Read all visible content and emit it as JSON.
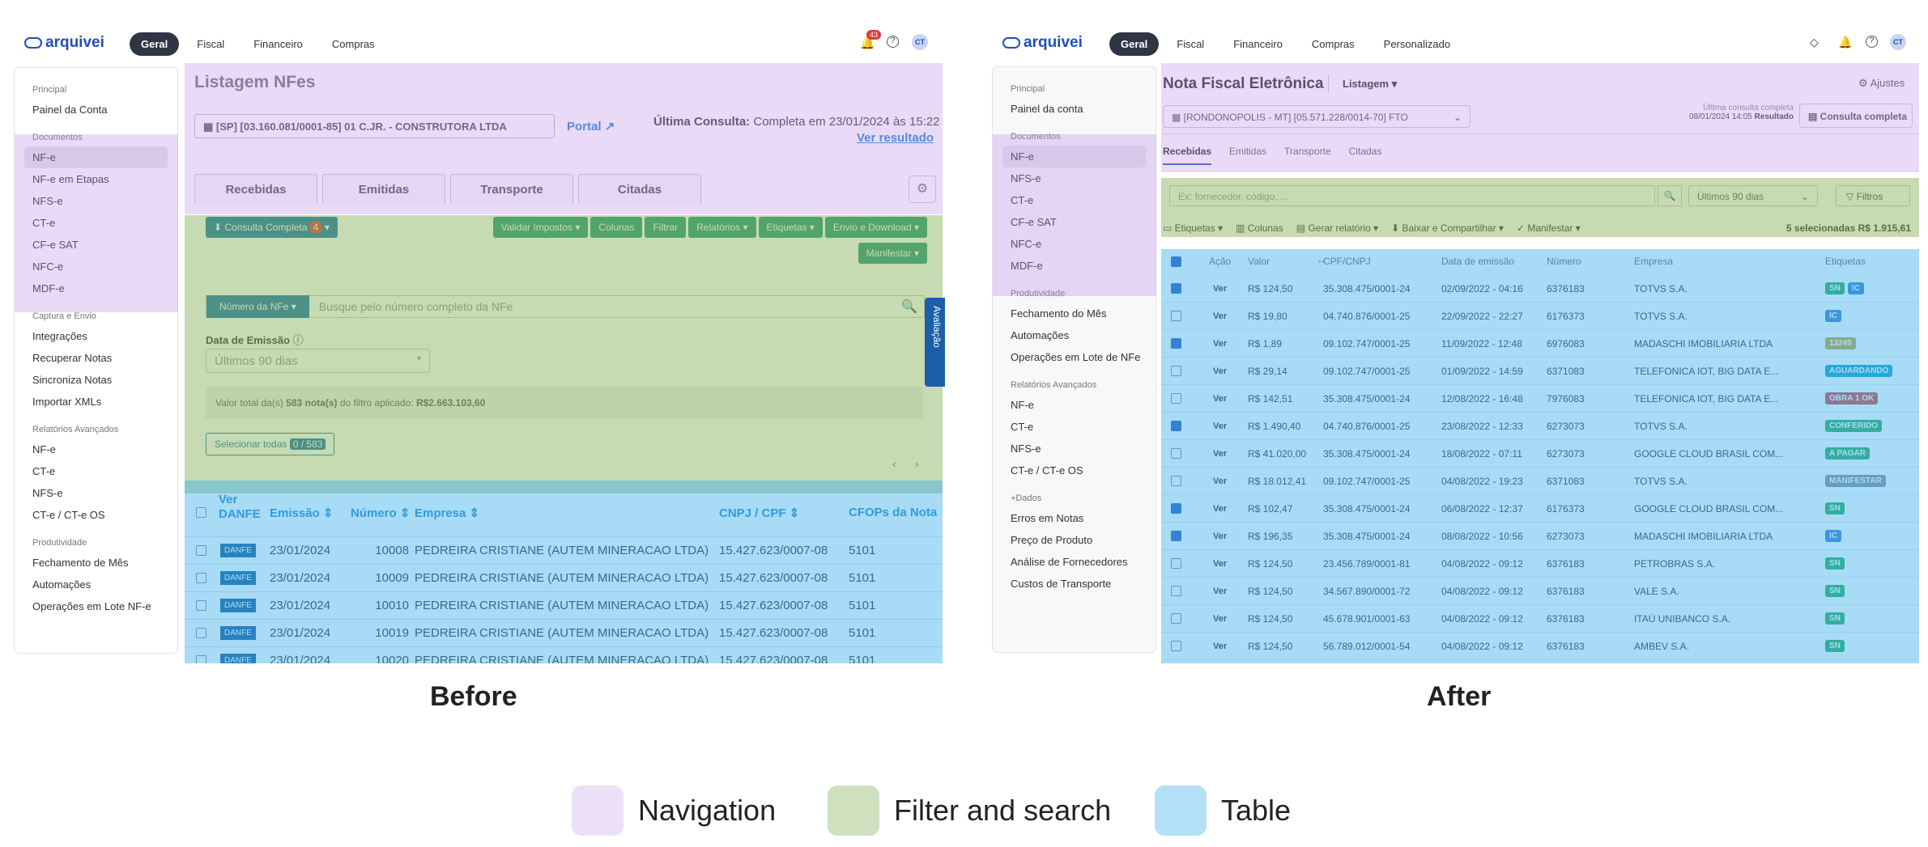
{
  "before": {
    "nav": {
      "brand": "arquivei",
      "tabs": [
        "Geral",
        "Fiscal",
        "Financeiro",
        "Compras"
      ],
      "notif_count": "43",
      "avatar": "CT"
    },
    "sidebar": [
      {
        "section": "Principal",
        "items": [
          "Painel da Conta"
        ]
      },
      {
        "section": "Documentos",
        "items": [
          "NF-e",
          "NF-e em Etapas",
          "NFS-e",
          "CT-e",
          "CF-e SAT",
          "NFC-e",
          "MDF-e"
        ]
      },
      {
        "section": "Captura e Envio",
        "items": [
          "Integrações",
          "Recuperar Notas",
          "Sincroniza Notas",
          "Importar XMLs"
        ]
      },
      {
        "section": "Relatórios Avançados",
        "items": [
          "NF-e",
          "CT-e",
          "NFS-e",
          "CT-e / CT-e OS"
        ]
      },
      {
        "section": "Produtividade",
        "items": [
          "Fechamento de Mês",
          "Automações",
          "Operações em Lote NF-e"
        ]
      }
    ],
    "title": "Listagem NFes",
    "company_select": "[SP] [03.160.081/0001-85] 01 C.JR. - CONSTRUTORA LTDA",
    "portal": "Portal",
    "last_label": "Última Consulta:",
    "last_value": "Completa em 23/01/2024 às 15:22",
    "ver_resultado": "Ver resultado",
    "tabs": [
      "Recebidas",
      "Emitidas",
      "Transporte",
      "Citadas"
    ],
    "consulta_btn": "Consulta Completa",
    "consulta_count": "4",
    "toolbar": [
      "Validar Impostos",
      "Colunas",
      "Filtrar",
      "Relatórios",
      "Etiquetas",
      "Envio e Download"
    ],
    "manifestar": "Manifestar",
    "search_type": "Número da NFe",
    "search_placeholder": "Busque pelo número completo da NFe",
    "date_label": "Data de Emissão",
    "date_value": "Últimos 90 dias",
    "total_text": "Valor total da(s)",
    "total_count": "583 nota(s)",
    "total_mid": "do filtro aplicado:",
    "total_value": "R$2.663.103,60",
    "select_all": "Selecionar todas",
    "select_badge": "0 / 583",
    "avaliacao": "Avaliação",
    "headers": [
      "Ver DANFE",
      "Emissão",
      "Número",
      "Empresa",
      "CNPJ / CPF",
      "CFOPs da Nota"
    ],
    "danfe": "DANFE",
    "rows": [
      [
        "23/01/2024",
        "10008",
        "PEDREIRA CRISTIANE (AUTEM MINERACAO LTDA)",
        "15.427.623/0007-08",
        "5101"
      ],
      [
        "23/01/2024",
        "10009",
        "PEDREIRA CRISTIANE (AUTEM MINERACAO LTDA)",
        "15.427.623/0007-08",
        "5101"
      ],
      [
        "23/01/2024",
        "10010",
        "PEDREIRA CRISTIANE (AUTEM MINERACAO LTDA)",
        "15.427.623/0007-08",
        "5101"
      ],
      [
        "23/01/2024",
        "10019",
        "PEDREIRA CRISTIANE (AUTEM MINERACAO LTDA)",
        "15.427.623/0007-08",
        "5101"
      ],
      [
        "23/01/2024",
        "10020",
        "PEDREIRA CRISTIANE (AUTEM MINERACAO LTDA)",
        "15.427.623/0007-08",
        "5101"
      ]
    ]
  },
  "after": {
    "nav": {
      "brand": "arquivei",
      "tabs": [
        "Geral",
        "Fiscal",
        "Financeiro",
        "Compras",
        "Personalizado"
      ],
      "avatar": "CT"
    },
    "sidebar": [
      {
        "section": "Principal",
        "items": [
          "Painel da conta"
        ]
      },
      {
        "section": "Documentos",
        "items": [
          "NF-e",
          "NFS-e",
          "CT-e",
          "CF-e SAT",
          "NFC-e",
          "MDF-e"
        ]
      },
      {
        "section": "Produtividade",
        "items": [
          "Fechamento do Mês",
          "Automações",
          "Operações em Lote de NFe"
        ]
      },
      {
        "section": "Relatórios Avançados",
        "items": [
          "NF-e",
          "CT-e",
          "NFS-e",
          "CT-e / CT-e OS"
        ]
      },
      {
        "section": "+Dados",
        "items": [
          "Erros em Notas",
          "Preço de Produto",
          "Análise de Fornecedores",
          "Custos de Transporte"
        ]
      }
    ],
    "title": "Nota Fiscal Eletrônica",
    "listagem": "Listagem",
    "ajustes": "Ajustes",
    "company_select": "[RONDONOPOLIS - MT] [05.571.228/0014-70] FTO",
    "last_label": "Última consulta completa",
    "last_value": "08/01/2024 14:05",
    "resultado": "Resultado",
    "consulta_btn": "Consulta completa",
    "tabs": [
      "Recebidas",
      "Emitidas",
      "Transporte",
      "Citadas"
    ],
    "search_placeholder": "Ex: fornecedor, código, ...",
    "date_value": "Últimos 90 dias",
    "filtros": "Filtros",
    "actions": [
      "Etiquetas",
      "Colunas",
      "Gerar relatório",
      "Baixar e Compartilhar",
      "Manifestar"
    ],
    "selected": "5 selecionadas R$ 1.915,61",
    "headers": [
      "Ação",
      "Valor",
      "CPF/CNPJ",
      "Data de emissão",
      "Número",
      "Empresa",
      "Etiquetas"
    ],
    "ver": "Ver",
    "rows": [
      {
        "checked": true,
        "valor": "R$ 124,50",
        "cnpj": "35.308.475/0001-24",
        "data": "02/09/2022 - 04:16",
        "numero": "6376183",
        "empresa": "TOTVS S.A.",
        "tags": [
          {
            "t": "SN",
            "c": "#2fae60"
          },
          {
            "t": "IC",
            "c": "#3b82d6"
          }
        ]
      },
      {
        "checked": false,
        "valor": "R$ 19,80",
        "cnpj": "04.740.876/0001-25",
        "data": "22/09/2022 - 22:27",
        "numero": "6176373",
        "empresa": "TOTVS S.A.",
        "tags": [
          {
            "t": "IC",
            "c": "#3b82d6"
          }
        ]
      },
      {
        "checked": true,
        "valor": "R$ 1,89",
        "cnpj": "09.102.747/0001-25",
        "data": "11/09/2022 - 12:48",
        "numero": "6976083",
        "empresa": "MADASCHI IMOBILIARIA LTDA",
        "tags": [
          {
            "t": "13249",
            "c": "#c9a437"
          }
        ]
      },
      {
        "checked": false,
        "valor": "R$ 29,14",
        "cnpj": "09.102.747/0001-25",
        "data": "01/09/2022 - 14:59",
        "numero": "6371083",
        "empresa": "TELEFONICA IOT, BIG DATA E...",
        "tags": [
          {
            "t": "AGUARDANDO",
            "c": "#1aa3c9"
          }
        ]
      },
      {
        "checked": false,
        "valor": "R$ 142,51",
        "cnpj": "35.308.475/0001-24",
        "data": "12/08/2022 - 16:48",
        "numero": "7976083",
        "empresa": "TELEFONICA IOT, BIG DATA E...",
        "tags": [
          {
            "t": "OBRA 1 OK",
            "c": "#d04a4a"
          }
        ]
      },
      {
        "checked": true,
        "valor": "R$ 1.490,40",
        "cnpj": "04.740.876/0001-25",
        "data": "23/08/2022 - 12:33",
        "numero": "6273073",
        "empresa": "TOTVS S.A.",
        "tags": [
          {
            "t": "CONFERIDO",
            "c": "#2fae60"
          }
        ]
      },
      {
        "checked": false,
        "valor": "R$ 41.020,00",
        "cnpj": "35.308.475/0001-24",
        "data": "18/08/2022 - 07:11",
        "numero": "6273073",
        "empresa": "GOOGLE CLOUD BRASIL COM...",
        "tags": [
          {
            "t": "A PAGAR",
            "c": "#2fae60"
          }
        ]
      },
      {
        "checked": false,
        "valor": "R$ 18.012,41",
        "cnpj": "09.102.747/0001-25",
        "data": "04/08/2022 - 19:23",
        "numero": "6371083",
        "empresa": "TOTVS S.A.",
        "tags": [
          {
            "t": "MANIFESTAR",
            "c": "#8a8f99"
          }
        ]
      },
      {
        "checked": true,
        "valor": "R$ 102,47",
        "cnpj": "35.308.475/0001-24",
        "data": "06/08/2022 - 12:37",
        "numero": "6176373",
        "empresa": "GOOGLE CLOUD BRASIL COM...",
        "tags": [
          {
            "t": "SN",
            "c": "#2fae60"
          }
        ]
      },
      {
        "checked": true,
        "valor": "R$ 196,35",
        "cnpj": "35.308.475/0001-24",
        "data": "08/08/2022 - 10:56",
        "numero": "6273073",
        "empresa": "MADASCHI IMOBILIARIA LTDA",
        "tags": [
          {
            "t": "IC",
            "c": "#3b82d6"
          }
        ]
      },
      {
        "checked": false,
        "valor": "R$ 124,50",
        "cnpj": "23.456.789/0001-81",
        "data": "04/08/2022 - 09:12",
        "numero": "6376183",
        "empresa": "PETROBRAS S.A.",
        "tags": [
          {
            "t": "SN",
            "c": "#2fae60"
          }
        ]
      },
      {
        "checked": false,
        "valor": "R$ 124,50",
        "cnpj": "34.567.890/0001-72",
        "data": "04/08/2022 - 09:12",
        "numero": "6376183",
        "empresa": "VALE S.A.",
        "tags": [
          {
            "t": "SN",
            "c": "#2fae60"
          }
        ]
      },
      {
        "checked": false,
        "valor": "R$ 124,50",
        "cnpj": "45.678.901/0001-63",
        "data": "04/08/2022 - 09:12",
        "numero": "6376183",
        "empresa": "ITAÚ UNIBANCO S.A.",
        "tags": [
          {
            "t": "SN",
            "c": "#2fae60"
          }
        ]
      },
      {
        "checked": false,
        "valor": "R$ 124,50",
        "cnpj": "56.789.012/0001-54",
        "data": "04/08/2022 - 09:12",
        "numero": "6376183",
        "empresa": "AMBEV S.A.",
        "tags": [
          {
            "t": "SN",
            "c": "#2fae60"
          }
        ]
      }
    ]
  },
  "captions": {
    "before": "Before",
    "after": "After"
  },
  "legend": [
    {
      "label": "Navigation",
      "color": "#ecdff8"
    },
    {
      "label": "Filter and search",
      "color": "#cfe0bf"
    },
    {
      "label": "Table",
      "color": "#b3e0f7"
    }
  ]
}
